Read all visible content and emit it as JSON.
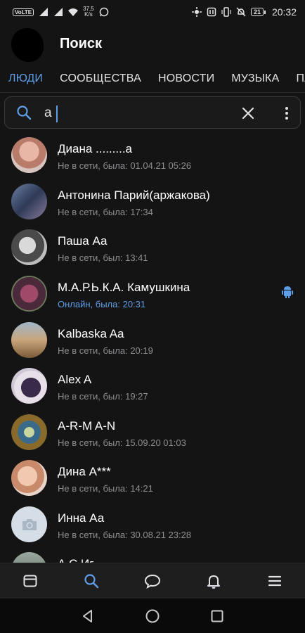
{
  "status_bar": {
    "left_badge": "VoLTE",
    "speed_value": "37,5",
    "speed_unit": "K/s",
    "battery": "21",
    "time": "20:32"
  },
  "header": {
    "title": "Поиск"
  },
  "tabs": [
    {
      "label": "ЛЮДИ",
      "active": true
    },
    {
      "label": "СООБЩЕСТВА"
    },
    {
      "label": "НОВОСТИ"
    },
    {
      "label": "МУЗЫКА"
    },
    {
      "label": "ПЛ"
    }
  ],
  "search": {
    "value": "а"
  },
  "people": [
    {
      "name": "Диана .........а",
      "status": "Не в сети, была: 01.04.21 05:26"
    },
    {
      "name": "Антонина Парий(аржакова)",
      "status": "Не в сети, была: 17:34"
    },
    {
      "name": "Паша Аа",
      "status": "Не в сети, был: 13:41"
    },
    {
      "name": "М.А.Р.Ь.К.А. Камушкина",
      "status": "Онлайн, была: 20:31",
      "online": true
    },
    {
      "name": "Kalbaska Aa",
      "status": "Не в сети, была: 20:19"
    },
    {
      "name": "Alex A",
      "status": "Не в сети, был: 19:27"
    },
    {
      "name": "A-R-M A-N",
      "status": "Не в сети, был: 15.09.20 01:03"
    },
    {
      "name": "Дина А***",
      "status": "Не в сети, была: 14:21"
    },
    {
      "name": "Инна Аа",
      "status": "Не в сети, была: 30.08.21 23:28"
    },
    {
      "name": "А С Иг...",
      "status": ""
    }
  ],
  "colors": {
    "accent": "#5e9ee8",
    "background": "#141414"
  },
  "icons": {
    "bottom_nav": [
      "news-icon",
      "search-icon",
      "messages-icon",
      "notifications-icon",
      "menu-icon"
    ],
    "system_nav": [
      "back-icon",
      "home-icon",
      "recents-icon"
    ]
  }
}
